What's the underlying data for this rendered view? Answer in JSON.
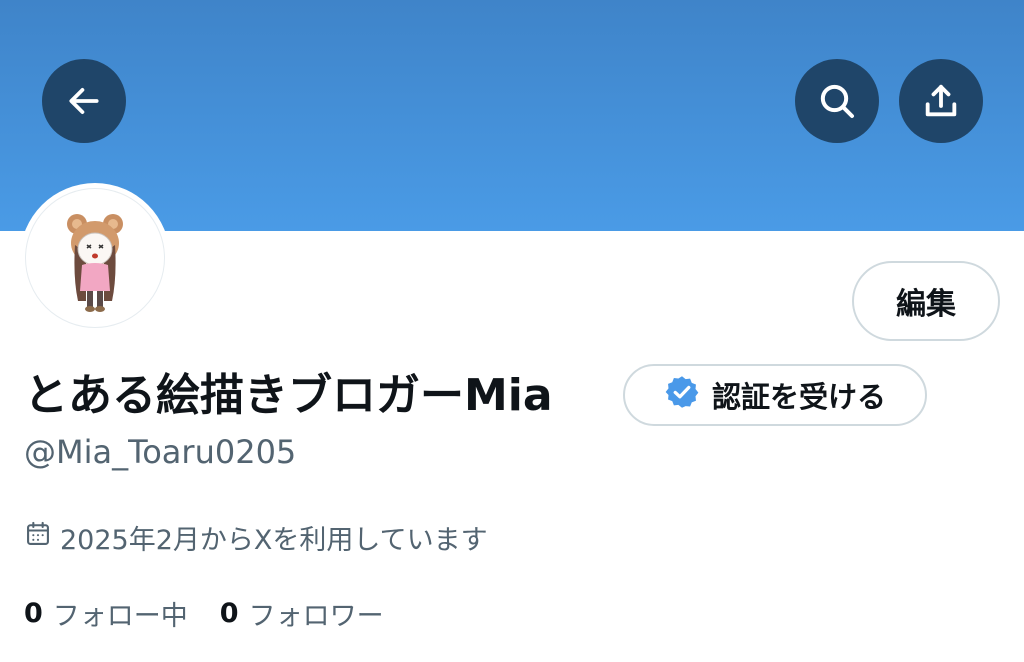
{
  "header": {
    "back_icon": "arrow-left-icon",
    "search_icon": "search-icon",
    "share_icon": "share-upload-icon",
    "banner_color": "#4a9be6",
    "button_color": "#1f4569"
  },
  "profile": {
    "display_name": "とある絵描きブロガーMia",
    "handle": "@Mia_Toaru0205",
    "edit_label": "編集",
    "verify_label": "認証を受ける",
    "verify_icon": "verified-badge-icon",
    "joined_icon": "calendar-icon",
    "joined_text": "2025年2月からXを利用しています"
  },
  "stats": {
    "following_count": "0",
    "following_label": "フォロー中",
    "followers_count": "0",
    "followers_label": "フォロワー"
  }
}
